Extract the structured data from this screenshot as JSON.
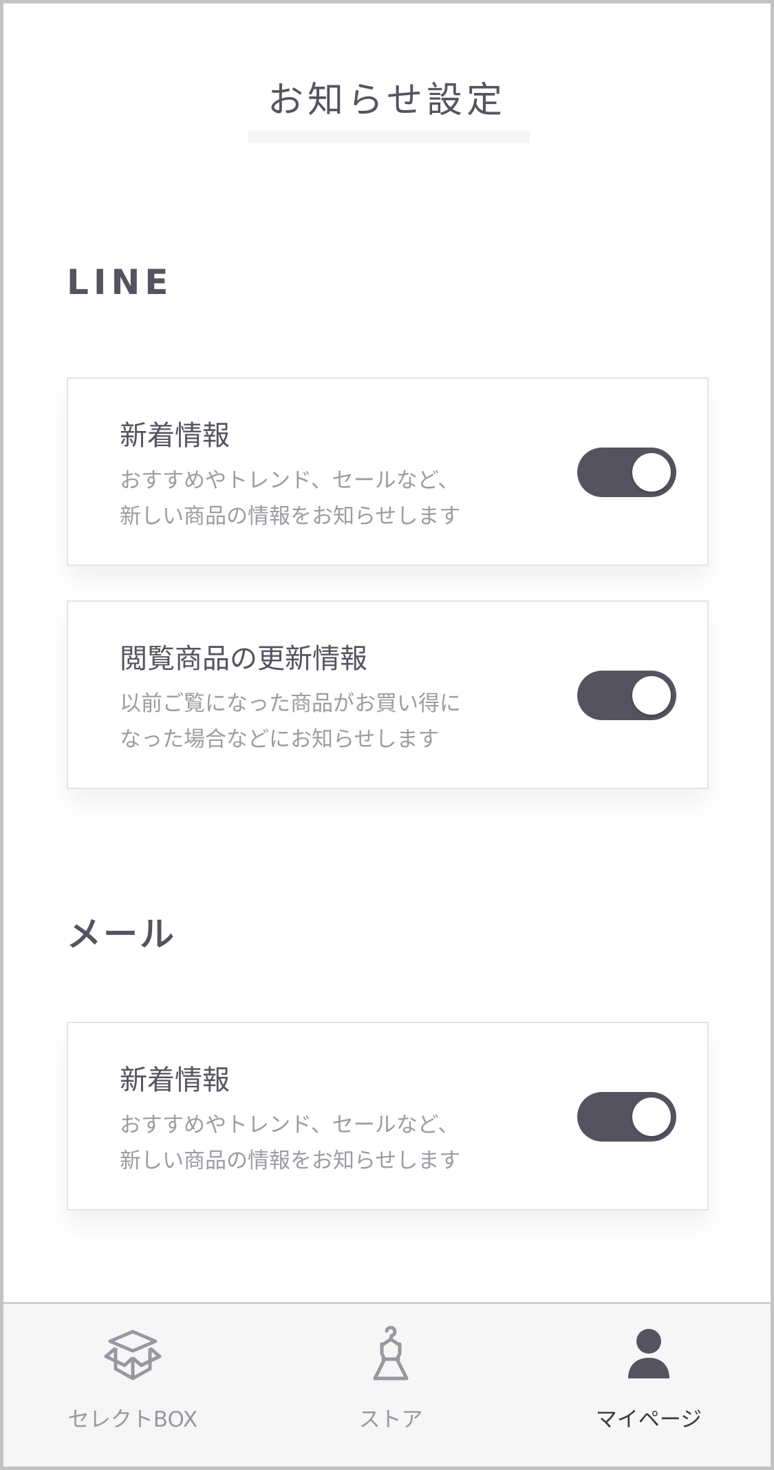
{
  "header": {
    "title": "お知らせ設定"
  },
  "sections": [
    {
      "heading": "LINE",
      "items": [
        {
          "title": "新着情報",
          "desc": [
            "おすすめやトレンド、セールなど、",
            "新しい商品の情報をお知らせします"
          ],
          "enabled": true
        },
        {
          "title": "閲覧商品の更新情報",
          "desc": [
            "以前ご覧になった商品がお買い得に",
            "なった場合などにお知らせします"
          ],
          "enabled": true
        }
      ]
    },
    {
      "heading": "メール",
      "items": [
        {
          "title": "新着情報",
          "desc": [
            "おすすめやトレンド、セールなど、",
            "新しい商品の情報をお知らせします"
          ],
          "enabled": true
        }
      ]
    }
  ],
  "tabbar": {
    "tabs": [
      {
        "label": "セレクトBOX",
        "icon": "box-icon",
        "active": false
      },
      {
        "label": "ストア",
        "icon": "dress-hanger-icon",
        "active": false
      },
      {
        "label": "マイページ",
        "icon": "user-icon",
        "active": true
      }
    ]
  },
  "colors": {
    "accent": "#55535f",
    "toggle_on": "#55535f",
    "muted_text": "#9d9ba3",
    "tab_inactive": "#99979f"
  }
}
